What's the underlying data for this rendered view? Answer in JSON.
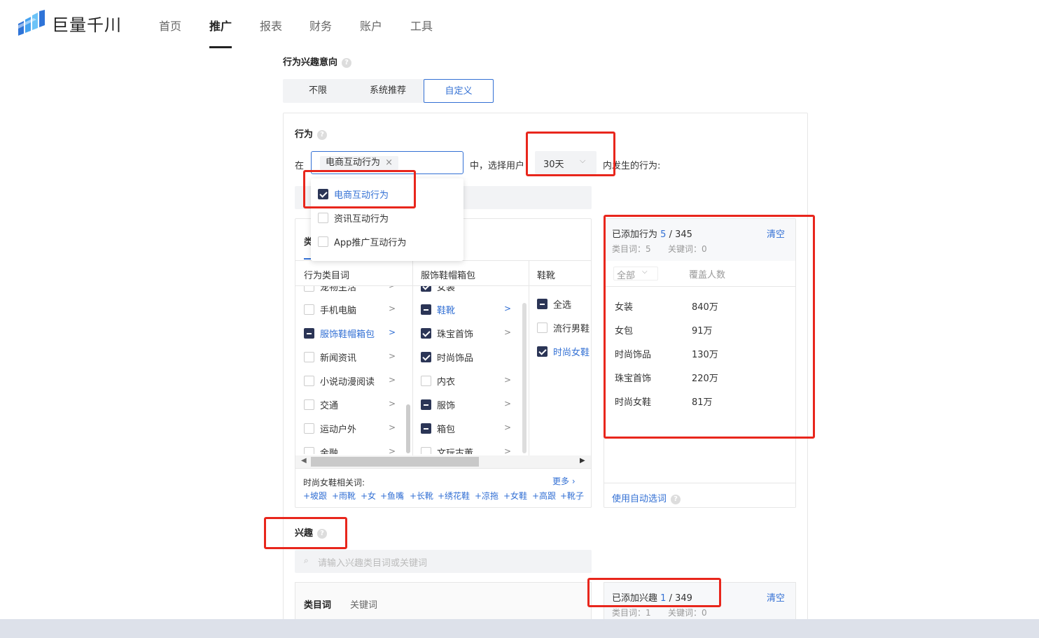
{
  "brand": {
    "name": "巨量千川"
  },
  "nav": {
    "items": [
      {
        "label": "首页"
      },
      {
        "label": "推广"
      },
      {
        "label": "报表"
      },
      {
        "label": "财务"
      },
      {
        "label": "账户"
      },
      {
        "label": "工具"
      }
    ],
    "active": "推广"
  },
  "section": {
    "title": "行为兴趣意向",
    "options": [
      "不限",
      "系统推荐",
      "自定义"
    ],
    "selected": "自定义"
  },
  "behavior": {
    "title": "行为",
    "prefix": "在",
    "selected_tag": "电商互动行为",
    "middle": "中，选择用户",
    "days": "30天",
    "suffix": "内发生的行为:",
    "dropdown": [
      {
        "label": "电商互动行为",
        "checked": true
      },
      {
        "label": "资讯互动行为",
        "checked": false
      },
      {
        "label": "App推广互动行为",
        "checked": false
      }
    ],
    "tab_partial": "类",
    "columns": {
      "col1_header": "行为类目词",
      "col2_header": "服饰鞋帽箱包",
      "col3_header": "鞋靴"
    },
    "col1_items": [
      {
        "label": "宠物生活",
        "state": "none"
      },
      {
        "label": "手机电脑",
        "state": "none"
      },
      {
        "label": "服饰鞋帽箱包",
        "state": "partial"
      },
      {
        "label": "新闻资讯",
        "state": "none"
      },
      {
        "label": "小说动漫阅读",
        "state": "none"
      },
      {
        "label": "交通",
        "state": "none"
      },
      {
        "label": "运动户外",
        "state": "none"
      },
      {
        "label": "金融",
        "state": "none"
      }
    ],
    "col2_items": [
      {
        "label": "女装",
        "state": "checked"
      },
      {
        "label": "鞋靴",
        "state": "partial"
      },
      {
        "label": "珠宝首饰",
        "state": "checked"
      },
      {
        "label": "时尚饰品",
        "state": "checked"
      },
      {
        "label": "内衣",
        "state": "none"
      },
      {
        "label": "服饰",
        "state": "partial"
      },
      {
        "label": "箱包",
        "state": "partial"
      },
      {
        "label": "文玩古董",
        "state": "none"
      }
    ],
    "col3_items": [
      {
        "label": "全选",
        "state": "partial"
      },
      {
        "label": "流行男鞋",
        "state": "none"
      },
      {
        "label": "时尚女鞋",
        "state": "checked"
      }
    ],
    "related_title": "时尚女鞋相关词:",
    "more": "更多",
    "related_words": [
      "+坡跟",
      "+雨靴",
      "+女",
      "+鱼嘴",
      "+长靴",
      "+绣花鞋",
      "+凉拖",
      "+女鞋",
      "+高跟",
      "+靴子"
    ],
    "added": {
      "label": "已添加行为",
      "count": "5",
      "total": "/ 345",
      "clear": "清空",
      "category_count": "类目词：5",
      "keyword_count": "关键词：0",
      "filter": "全部",
      "coverage_header": "覆盖人数",
      "items": [
        {
          "name": "女装",
          "coverage": "840万"
        },
        {
          "name": "女包",
          "coverage": "91万"
        },
        {
          "name": "时尚饰品",
          "coverage": "130万"
        },
        {
          "name": "珠宝首饰",
          "coverage": "220万"
        },
        {
          "name": "时尚女鞋",
          "coverage": "81万"
        }
      ],
      "auto_select": "使用自动选词"
    }
  },
  "interest": {
    "title": "兴趣",
    "search_placeholder": "请输入兴趣类目词或关键词",
    "tabs": [
      "类目词",
      "关键词"
    ],
    "added": {
      "label": "已添加兴趣",
      "count": "1",
      "total": "/ 349",
      "clear": "清空",
      "category_count": "类目词：1",
      "keyword_count": "关键词：0"
    }
  },
  "colors": {
    "accent": "#3370d4",
    "check": "#2b3556",
    "highlight": "#e8261c"
  }
}
